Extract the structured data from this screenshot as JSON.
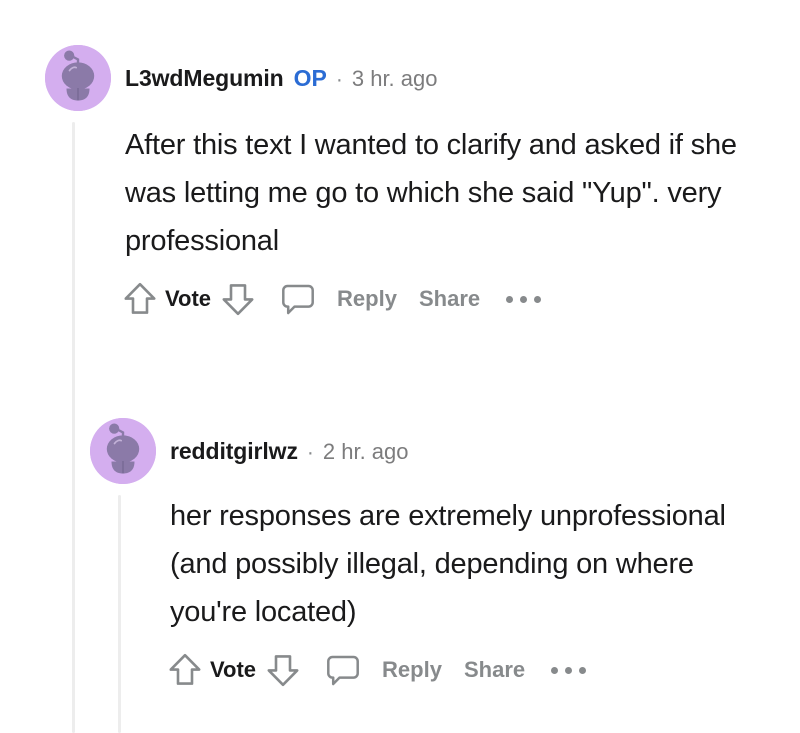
{
  "thread": {
    "colors": {
      "avatar_background": "#D4AEEF",
      "avatar_figure": "#8B7AA8",
      "op_badge": "#2B6CD4",
      "muted_text": "#878A8C",
      "body_text": "#1A1A1B",
      "thread_line": "#EDEDED",
      "page_background": "#FFFFFF"
    },
    "comments": [
      {
        "username": "L3wdMegumin",
        "op_badge": "OP",
        "separator": "·",
        "timestamp": "3 hr. ago",
        "body": "After this text I wanted to clarify and asked if she was letting me go to which she said \"Yup\". very professional",
        "actions": {
          "upvote_icon": "upvote-arrow-icon",
          "vote_label": "Vote",
          "downvote_icon": "downvote-arrow-icon",
          "comment_icon": "comment-bubble-icon",
          "reply_label": "Reply",
          "share_label": "Share",
          "overflow_icon": "more-options-icon"
        }
      },
      {
        "username": "redditgirlwz",
        "op_badge": "",
        "separator": "·",
        "timestamp": "2 hr. ago",
        "body": "her responses are extremely unprofessional (and possibly illegal, depending on where you're located)",
        "actions": {
          "upvote_icon": "upvote-arrow-icon",
          "vote_label": "Vote",
          "downvote_icon": "downvote-arrow-icon",
          "comment_icon": "comment-bubble-icon",
          "reply_label": "Reply",
          "share_label": "Share",
          "overflow_icon": "more-options-icon"
        }
      }
    ]
  }
}
